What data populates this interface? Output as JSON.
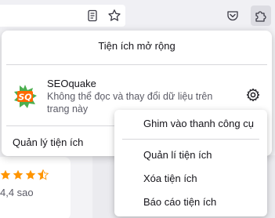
{
  "toolbar": {
    "icons": [
      "reader-view-icon",
      "bookmark-star-icon",
      "pocket-icon",
      "extensions-puzzle-icon"
    ]
  },
  "popup": {
    "title": "Tiện ích mở rộng",
    "extension": {
      "name": "SEOquake",
      "description": "Không thể đọc và thay đổi dữ liệu trên trang này",
      "logo_text": "SQ"
    },
    "manage_label": "Quản lý tiện ích"
  },
  "context_menu": {
    "items": [
      {
        "label": "Ghim vào thanh công cụ"
      },
      {
        "label": "Quản lí tiện ích"
      },
      {
        "label": "Xóa tiện ích"
      },
      {
        "label": "Báo cáo tiện ích"
      }
    ]
  },
  "background": {
    "rating_text": "4,4 sao",
    "rating_value": 4.4,
    "rating_max": 5
  },
  "colors": {
    "star": "#ff9500",
    "seoquake_green": "#4caf50",
    "seoquake_orange": "#ff6a00"
  }
}
